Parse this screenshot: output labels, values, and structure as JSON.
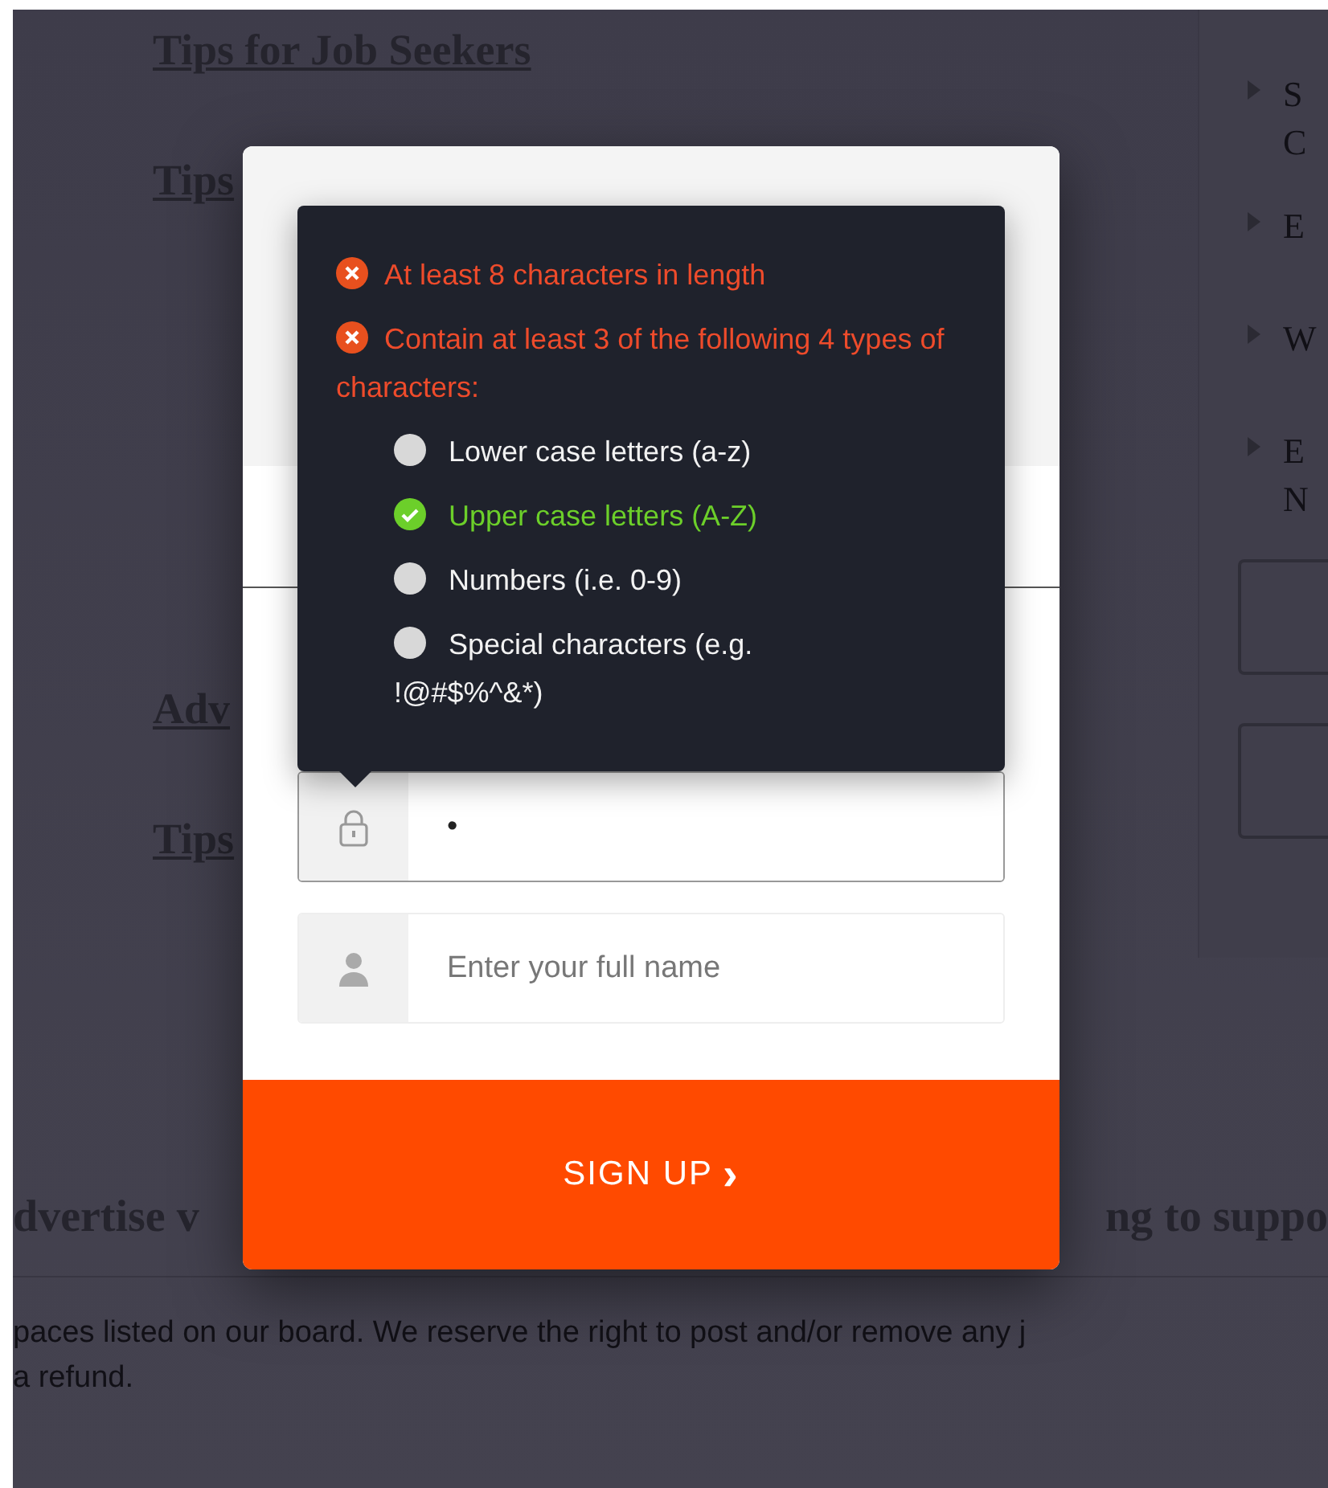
{
  "background_page": {
    "links": [
      {
        "text": "Tips for Job Seekers"
      },
      {
        "text": "Tips"
      },
      {
        "text": "Adv"
      },
      {
        "text": "Tips"
      }
    ],
    "heading": {
      "left": "dvertise v",
      "right": "ng to suppo"
    },
    "paragraph": [
      "paces listed on our board. We reserve the right to post and/or remove any j",
      "a refund."
    ],
    "sidebar": {
      "items": [
        {
          "lines": [
            "S",
            "C"
          ]
        },
        {
          "lines": [
            "E"
          ]
        },
        {
          "lines": [
            "W"
          ]
        },
        {
          "lines": [
            "E",
            "N"
          ]
        }
      ]
    }
  },
  "modal": {
    "password_tooltip": {
      "rules": [
        {
          "text": "At least 8 characters in length",
          "met": false
        },
        {
          "text": "Contain at least 3 of the following 4 types of characters:",
          "met": false,
          "children": [
            {
              "text": "Lower case letters (a-z)",
              "met": false
            },
            {
              "text": "Upper case letters (A-Z)",
              "met": true
            },
            {
              "text": "Numbers (i.e. 0-9)",
              "met": false
            },
            {
              "text": "Special characters (e.g. !@#$%^&*)",
              "met": false
            }
          ]
        }
      ]
    },
    "fields": [
      {
        "kind": "password",
        "value": "•",
        "focused": true
      },
      {
        "kind": "name",
        "placeholder": "Enter your full name",
        "focused": false
      }
    ],
    "submit": {
      "label": "SIGN UP",
      "chevron": "›"
    }
  }
}
